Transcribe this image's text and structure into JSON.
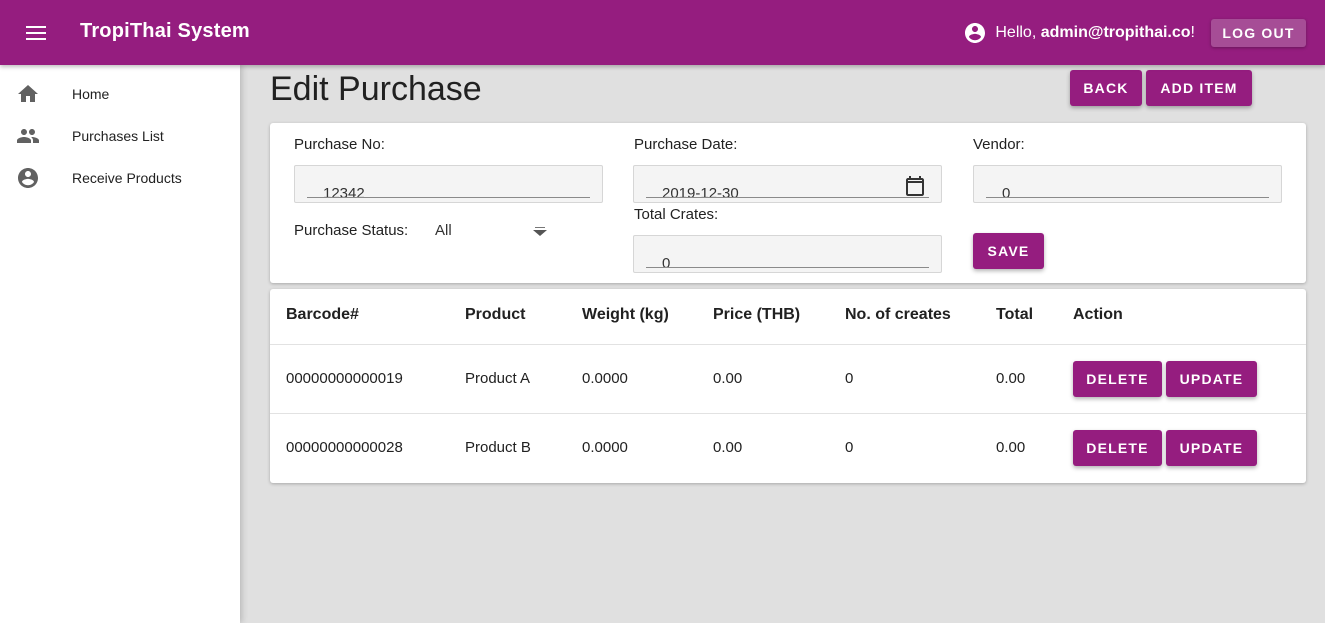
{
  "app": {
    "title": "TropiThai System",
    "greeting_prefix": "Hello, ",
    "user": "admin@tropithai.co",
    "greeting_suffix": "!",
    "logout_label": "LOG OUT"
  },
  "sidebar": {
    "items": [
      {
        "label": "Home",
        "icon": "home-icon"
      },
      {
        "label": "Purchases List",
        "icon": "people-icon"
      },
      {
        "label": "Receive Products",
        "icon": "account-circle-icon"
      }
    ]
  },
  "page": {
    "title": "Edit Purchase",
    "back_label": "BACK",
    "add_item_label": "ADD ITEM"
  },
  "form": {
    "purchase_no": {
      "label": "Purchase No:",
      "value": "12342"
    },
    "purchase_date": {
      "label": "Purchase Date:",
      "value": "2019-12-30"
    },
    "vendor": {
      "label": "Vendor:",
      "value": "0"
    },
    "purchase_status": {
      "label": "Purchase Status:",
      "value": "All"
    },
    "total_crates": {
      "label": "Total Crates:",
      "value": "0"
    },
    "save_label": "SAVE"
  },
  "table": {
    "headers": [
      "Barcode#",
      "Product",
      "Weight (kg)",
      "Price (THB)",
      "No. of creates",
      "Total",
      "Action"
    ],
    "rows": [
      {
        "barcode": "00000000000019",
        "product": "Product A",
        "weight": "0.0000",
        "price": "0.00",
        "crates": "0",
        "total": "0.00"
      },
      {
        "barcode": "00000000000028",
        "product": "Product B",
        "weight": "0.0000",
        "price": "0.00",
        "crates": "0",
        "total": "0.00"
      }
    ],
    "delete_label": "DELETE",
    "update_label": "UPDATE"
  },
  "colors": {
    "primary": "#951d7f",
    "logout_button": "#a64d96",
    "background": "#e0e0e0"
  }
}
